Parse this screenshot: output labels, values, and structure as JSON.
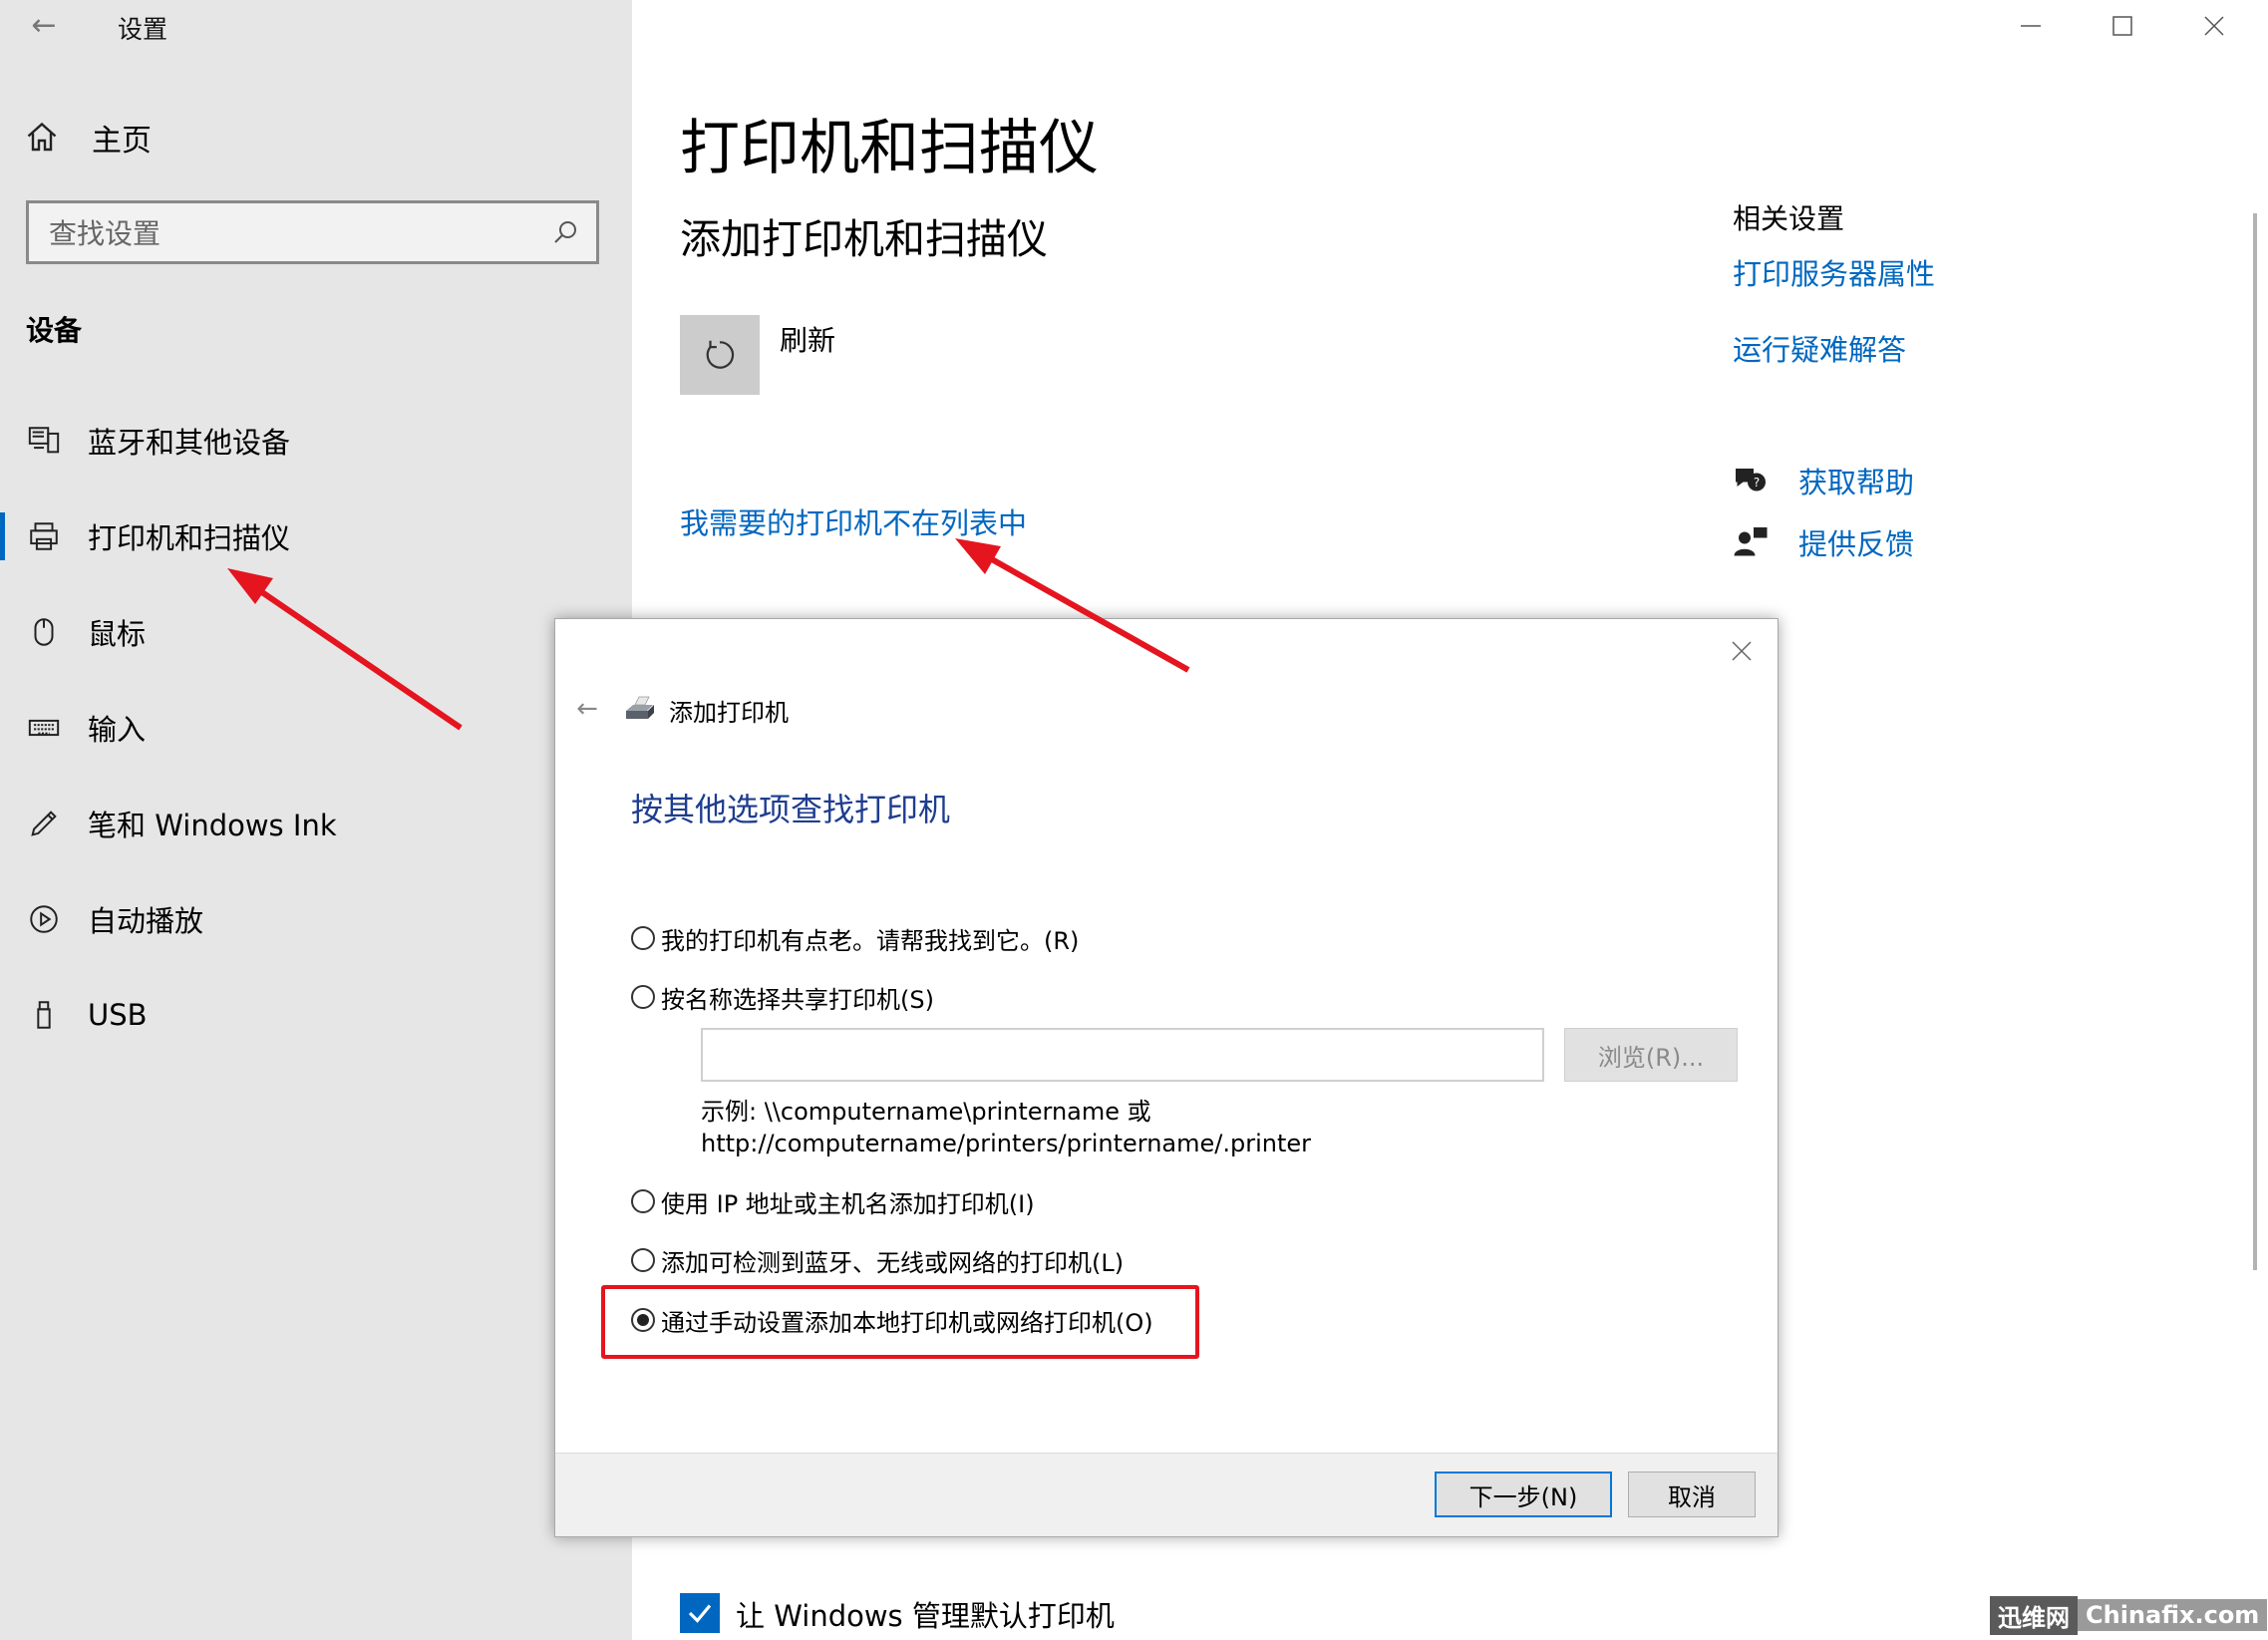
{
  "app": {
    "title": "设置"
  },
  "sidebar": {
    "home_label": "主页",
    "search_placeholder": "查找设置",
    "section_label": "设备",
    "items": [
      {
        "label": "蓝牙和其他设备",
        "icon": "bluetooth-device-icon"
      },
      {
        "label": "打印机和扫描仪",
        "icon": "printer-icon",
        "active": true
      },
      {
        "label": "鼠标",
        "icon": "mouse-icon"
      },
      {
        "label": "输入",
        "icon": "keyboard-icon"
      },
      {
        "label": "笔和 Windows Ink",
        "icon": "pen-icon"
      },
      {
        "label": "自动播放",
        "icon": "autoplay-icon"
      },
      {
        "label": "USB",
        "icon": "usb-icon"
      }
    ]
  },
  "main": {
    "title": "打印机和扫描仪",
    "subtitle": "添加打印机和扫描仪",
    "refresh_label": "刷新",
    "not_listed_link": "我需要的打印机不在列表中",
    "default_printer_label": "让 Windows 管理默认打印机"
  },
  "related": {
    "heading": "相关设置",
    "links": [
      "打印服务器属性",
      "运行疑难解答"
    ],
    "help": [
      {
        "label": "获取帮助",
        "icon": "help-chat-icon"
      },
      {
        "label": "提供反馈",
        "icon": "feedback-icon"
      }
    ]
  },
  "dialog": {
    "title": "添加打印机",
    "heading": "按其他选项查找打印机",
    "options": [
      {
        "label": "我的打印机有点老。请帮我找到它。(R)",
        "checked": false
      },
      {
        "label": "按名称选择共享打印机(S)",
        "checked": false
      },
      {
        "label": "使用 IP 地址或主机名添加打印机(I)",
        "checked": false
      },
      {
        "label": "添加可检测到蓝牙、无线或网络的打印机(L)",
        "checked": false
      },
      {
        "label": "通过手动设置添加本地打印机或网络打印机(O)",
        "checked": true
      }
    ],
    "share_input_value": "",
    "browse_label": "浏览(R)...",
    "example_line1": "示例: \\\\computername\\printername 或",
    "example_line2": "http://computername/printers/printername/.printer",
    "next_label": "下一步(N)",
    "cancel_label": "取消"
  },
  "watermark": {
    "cn": "迅维网",
    "en": "Chinafix.com"
  },
  "colors": {
    "accent": "#0067c0",
    "highlight": "#e4151f",
    "sidebar_bg": "#e6e6e6"
  }
}
